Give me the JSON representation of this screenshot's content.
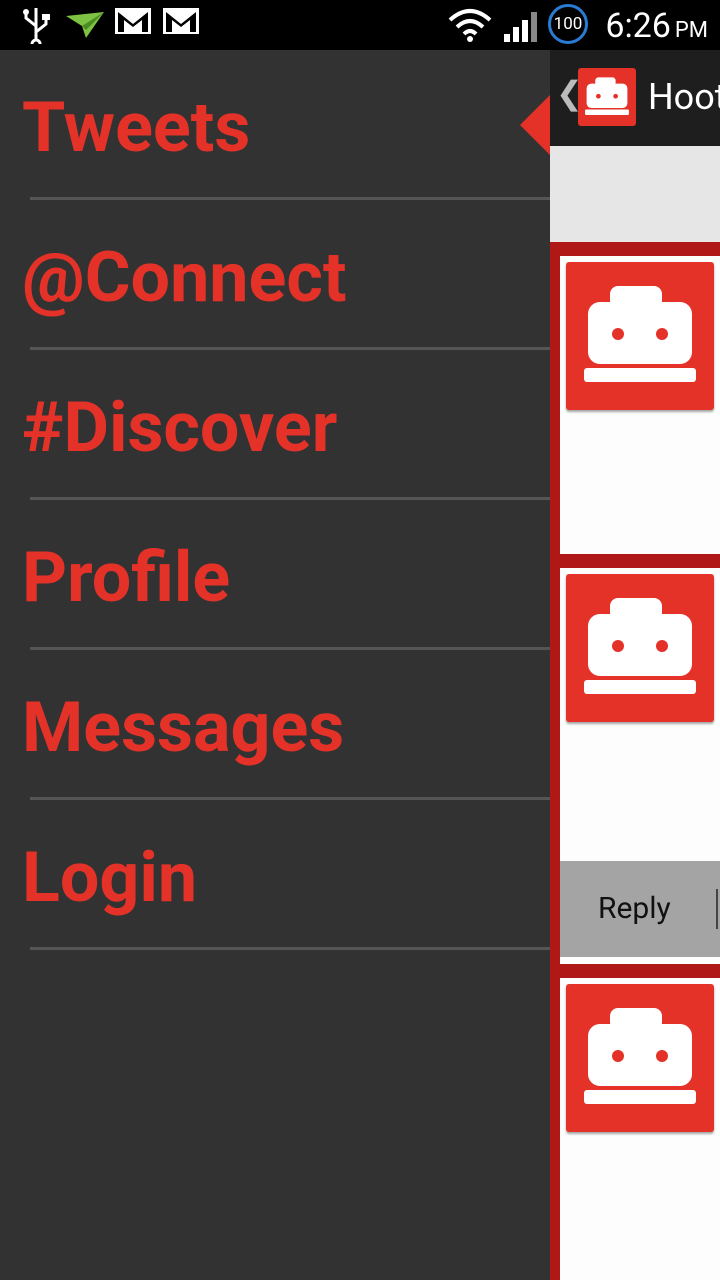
{
  "status_bar": {
    "time": "6:26",
    "ampm": "PM",
    "battery": "100",
    "icons": [
      "usb-icon",
      "airdroid-icon",
      "gmail-icon",
      "gmail-icon",
      "wifi-icon",
      "signal-icon"
    ]
  },
  "menu": {
    "items": [
      {
        "label": "Tweets"
      },
      {
        "label": "@Connect"
      },
      {
        "label": "#Discover"
      },
      {
        "label": "Profile"
      },
      {
        "label": "Messages"
      },
      {
        "label": "Login"
      }
    ]
  },
  "main": {
    "title": "Hoot",
    "reply_label": "Reply"
  },
  "colors": {
    "accent": "#e53229",
    "drawer_bg": "#323232",
    "divider": "#555555"
  }
}
